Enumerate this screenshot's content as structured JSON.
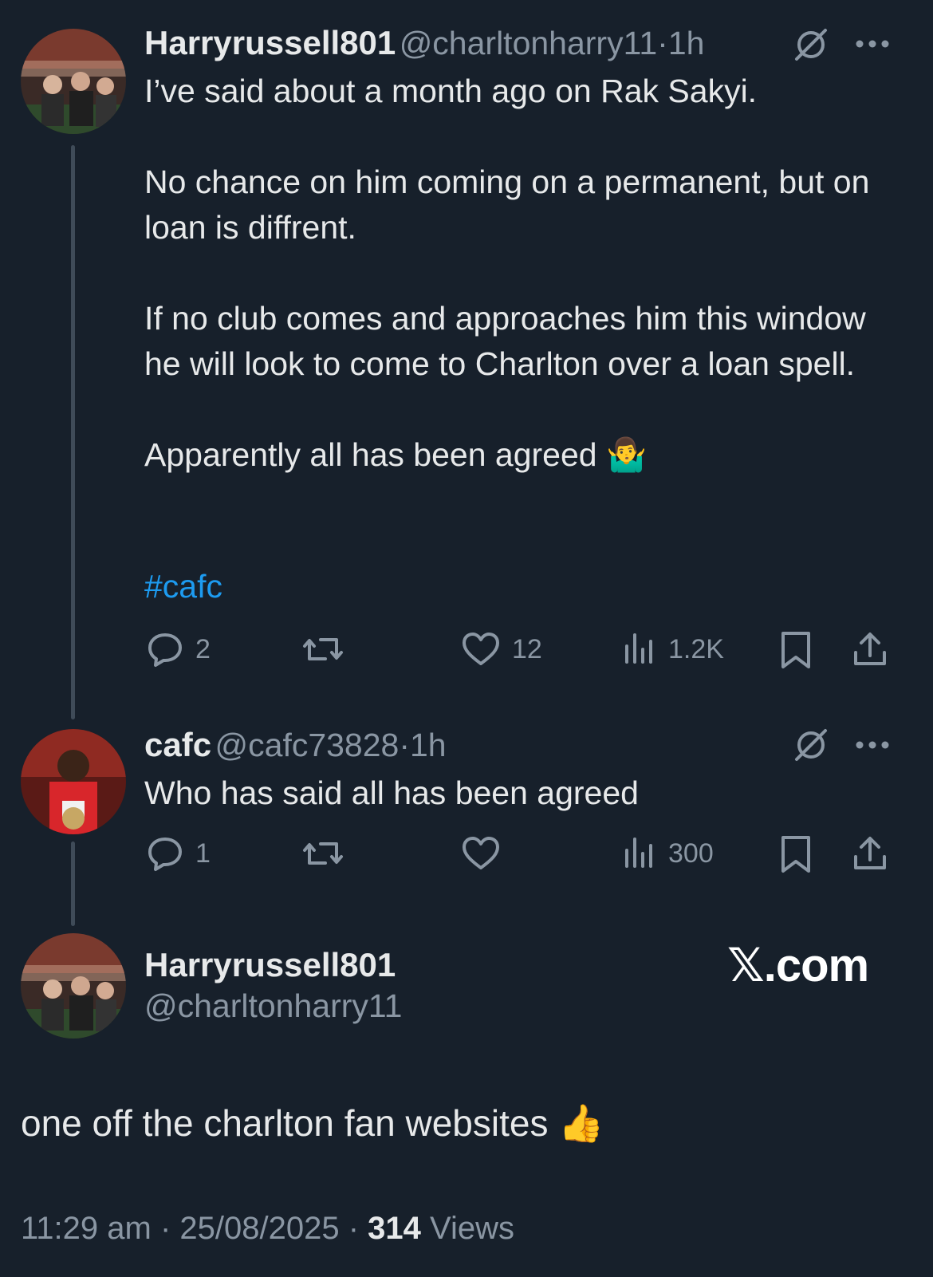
{
  "tweet1": {
    "name": "Harryrussell801",
    "handle": "@charltonharry11",
    "sep": "·",
    "time": "1h",
    "text": "I’ve said about a month ago on Rak Sakyi.\n\nNo chance on him coming on a permanent, but on loan is diffrent.\n\nIf no club comes and approaches him this window he will look to come to Charlton over a loan spell.\n\nApparently all has been agreed 🤷‍♂️",
    "hashtag": "#cafc",
    "replies": "2",
    "reposts": "",
    "likes": "12",
    "views": "1.2K"
  },
  "tweet2": {
    "name": "cafc",
    "handle": "@cafc73828",
    "sep": "·",
    "time": "1h",
    "text": "Who has said all has been agreed",
    "replies": "1",
    "reposts": "",
    "likes": "",
    "views": "300"
  },
  "main_tweet": {
    "name": "Harryrussell801",
    "handle": "@charltonharry11",
    "brand": "𝕏.com",
    "text": "one off the charlton fan websites 👍",
    "time": "11:29 am",
    "sep": "·",
    "date": "25/08/2025",
    "views_count": "314",
    "views_label": "Views"
  },
  "icons": {
    "reply": "reply-icon",
    "repost": "repost-icon",
    "like": "heart-icon",
    "views": "views-icon",
    "bookmark": "bookmark-icon",
    "share": "share-icon",
    "more": "more-icon",
    "grok": "grok-icon"
  },
  "colors": {
    "background": "#17202b",
    "text": "#e7e9ea",
    "muted": "#8a96a3",
    "link": "#1d9bf0"
  }
}
